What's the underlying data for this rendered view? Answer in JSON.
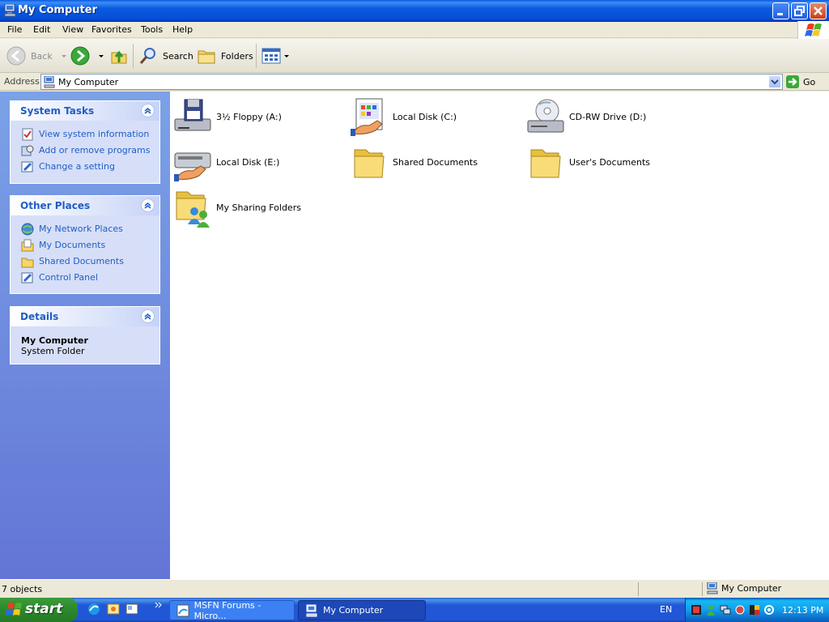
{
  "window": {
    "title": "My Computer"
  },
  "menu": [
    "File",
    "Edit",
    "View",
    "Favorites",
    "Tools",
    "Help"
  ],
  "toolbar": {
    "back": "Back",
    "search": "Search",
    "folders": "Folders"
  },
  "address": {
    "label": "Address",
    "value": "My Computer",
    "go": "Go"
  },
  "panels": {
    "system_tasks": {
      "title": "System Tasks",
      "items": [
        {
          "label": "View system information",
          "icon": "system-info-icon"
        },
        {
          "label": "Add or remove programs",
          "icon": "add-remove-icon"
        },
        {
          "label": "Change a setting",
          "icon": "control-panel-icon"
        }
      ]
    },
    "other_places": {
      "title": "Other Places",
      "items": [
        {
          "label": "My Network Places",
          "icon": "network-icon"
        },
        {
          "label": "My Documents",
          "icon": "documents-icon"
        },
        {
          "label": "Shared Documents",
          "icon": "folder-icon"
        },
        {
          "label": "Control Panel",
          "icon": "control-panel-icon"
        }
      ]
    },
    "details": {
      "title": "Details",
      "name": "My Computer",
      "type": "System Folder"
    }
  },
  "items": [
    {
      "label": "3½ Floppy (A:)",
      "icon": "floppy-drive-icon"
    },
    {
      "label": "Local Disk (C:)",
      "icon": "shared-disk-icon"
    },
    {
      "label": "CD-RW Drive (D:)",
      "icon": "cd-drive-icon"
    },
    {
      "label": "Local Disk (E:)",
      "icon": "shared-disk-icon"
    },
    {
      "label": "Shared Documents",
      "icon": "folder-icon"
    },
    {
      "label": "User's Documents",
      "icon": "folder-icon"
    },
    {
      "label": "My Sharing Folders",
      "icon": "sharing-folder-icon"
    }
  ],
  "status": {
    "count": "7 objects",
    "location": "My Computer"
  },
  "taskbar": {
    "start": "start",
    "tasks": [
      {
        "label": "MSFN Forums - Micro...",
        "active": false
      },
      {
        "label": "My Computer",
        "active": true
      }
    ],
    "language": "EN",
    "clock": "12:13 PM"
  },
  "colors": {
    "title_blue": "#0a5ae0",
    "link_blue": "#215dc6",
    "sidebar": "#7ba2e7",
    "start_green": "#3c9d3c"
  }
}
